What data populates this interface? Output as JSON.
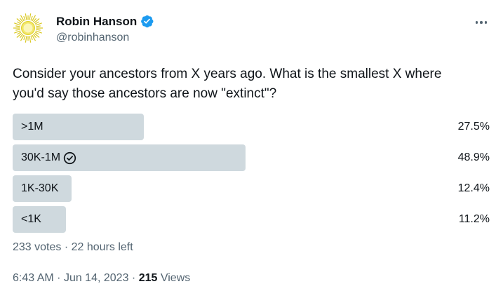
{
  "author": {
    "name": "Robin Hanson",
    "handle": "@robinhanson",
    "verified": true
  },
  "tweet": {
    "text_line1": "Consider your ancestors from X years ago. What is the smallest X where",
    "text_line2": "you'd say those ancestors are now \"extinct\"?"
  },
  "poll": {
    "options": [
      {
        "label": ">1M",
        "percent": "27.5%",
        "share": 0.275,
        "winner": false
      },
      {
        "label": "30K-1M",
        "percent": "48.9%",
        "share": 0.489,
        "winner": true
      },
      {
        "label": "1K-30K",
        "percent": "12.4%",
        "share": 0.124,
        "winner": false
      },
      {
        "label": "<1K",
        "percent": "11.2%",
        "share": 0.112,
        "winner": false
      }
    ],
    "votes": "233 votes",
    "time_left": "22 hours left",
    "separator": "·"
  },
  "meta": {
    "time": "6:43 AM",
    "date": "Jun 14, 2023",
    "views_count": "215",
    "views_label": "Views",
    "separator": "·"
  },
  "icons": {
    "avatar": "sun-avatar-icon",
    "verified": "verified-badge-icon",
    "more": "more-icon",
    "check": "check-circle-icon"
  },
  "colors": {
    "bar": "#cfd9de",
    "verified": "#1d9bf0",
    "secondary_text": "#536471",
    "primary_text": "#0f1419"
  }
}
